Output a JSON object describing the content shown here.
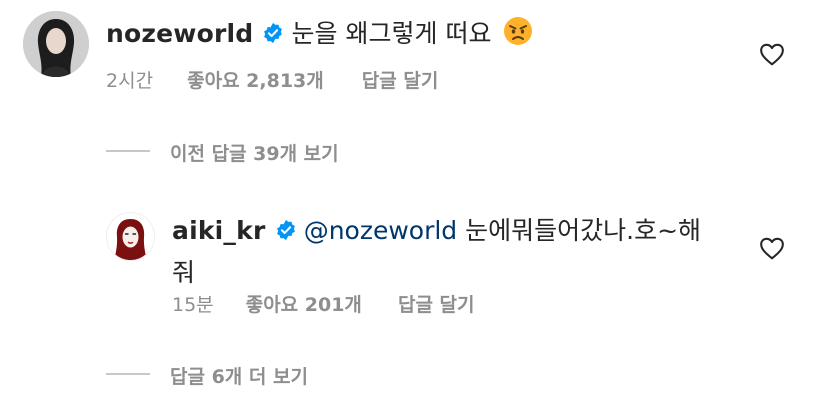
{
  "comment": {
    "username": "nozeworld",
    "text": "눈을 왜그렇게 떠요",
    "emoji_icon": "angry-face-emoji",
    "time": "2시간",
    "likes": "좋아요 2,813개",
    "reply_label": "답글 달기"
  },
  "previous_replies": {
    "label": "이전 답글 39개 보기"
  },
  "reply": {
    "username": "aiki_kr",
    "mention": "@nozeworld",
    "text_line1": " 눈에뭐들어갔나.호~해",
    "text_line2": "줘",
    "time": "15분",
    "likes": "좋아요 201개",
    "reply_label": "답글 달기"
  },
  "more_replies": {
    "label": "답글 6개 더 보기"
  },
  "colors": {
    "verified": "#0095f6",
    "mention": "#00376b",
    "meta": "#8e8e8e",
    "emoji": "#ffb12b",
    "emoji_dark": "#e03a2a"
  }
}
